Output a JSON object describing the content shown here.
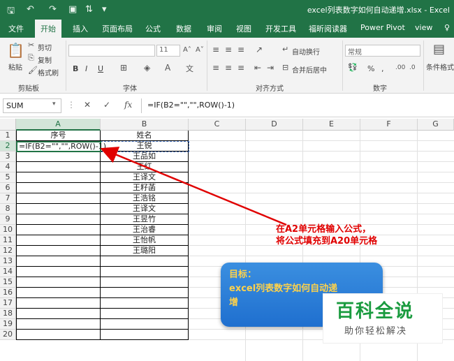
{
  "window": {
    "title": "excel列表数字如何自动递增.xlsx - Excel",
    "quick_access": {
      "save_icon": "save-icon",
      "undo_icon": "undo-icon",
      "redo_icon": "redo-icon"
    }
  },
  "tabs": [
    "文件",
    "开始",
    "插入",
    "页面布局",
    "公式",
    "数据",
    "审阅",
    "视图",
    "开发工具",
    "福昕阅读器",
    "Power Pivot",
    "view"
  ],
  "active_tab": "开始",
  "ribbon": {
    "clipboard": {
      "paste": "粘贴",
      "cut": "剪切",
      "copy": "复制",
      "format_painter": "格式刷",
      "group": "剪贴板"
    },
    "font": {
      "font_size": "11",
      "bold": "B",
      "italic": "I",
      "underline": "U",
      "group": "字体"
    },
    "alignment": {
      "wrap_text": "自动换行",
      "merge_center": "合并后居中",
      "group": "对齐方式"
    },
    "number": {
      "format": "常规",
      "percent": "%",
      "comma": ",",
      "group": "数字"
    },
    "styles": {
      "conditional": "条件格式"
    }
  },
  "formula_bar": {
    "name_box": "SUM",
    "cancel": "✕",
    "enter": "✓",
    "fx": "fx",
    "formula": "=IF(B2=\"\",\"\",ROW()-1)"
  },
  "grid": {
    "columns": [
      "A",
      "B",
      "C",
      "D",
      "E",
      "F",
      "G"
    ],
    "rows": [
      "1",
      "2",
      "3",
      "4",
      "5",
      "6",
      "7",
      "8",
      "9",
      "10",
      "11",
      "12",
      "13",
      "14",
      "15",
      "16",
      "17",
      "18",
      "19",
      "20"
    ],
    "header_a1": "序号",
    "header_b1": "姓名",
    "active_cell_text": "=IF(B2=\"\",\"\",ROW()-1)",
    "names": [
      "王锐",
      "王品如",
      "王红",
      "王译文",
      "王籽菡",
      "王浩铭",
      "王译文",
      "王昱竹",
      "王治睿",
      "王怡帆",
      "王璐阳"
    ]
  },
  "annotations": {
    "note_line1": "在A2单元格输入公式，",
    "note_line2": "将公式填充到A20单元格",
    "goal_line1": "目标：",
    "goal_line2": "excel列表数字如何自动递",
    "goal_line3": "增"
  },
  "watermark": {
    "main": "百科全说",
    "sub": "助你轻松解决"
  },
  "colors": {
    "excel_green": "#217346",
    "note_red": "#e00000",
    "goal_blue": "#1f6fcf",
    "goal_text": "#ffd24a",
    "logo_green": "#1a9b3f"
  }
}
